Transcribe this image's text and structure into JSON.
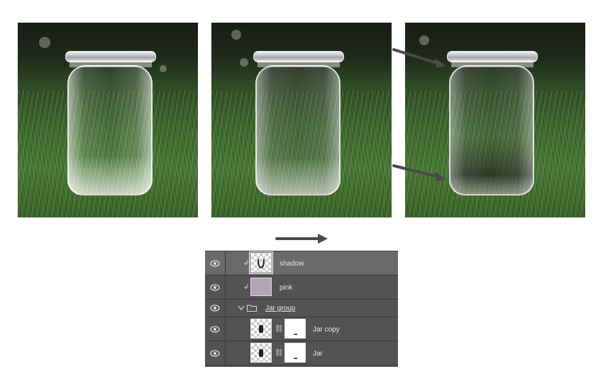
{
  "photos": [
    {
      "label": "original-jar"
    },
    {
      "label": "pink-tint-jar"
    },
    {
      "label": "shadow-jar"
    }
  ],
  "layers": [
    {
      "name": "shadow",
      "kind": "clipped-layer",
      "icon": "clip-arrow-icon",
      "selected": true
    },
    {
      "name": "pink",
      "kind": "clipped-fill",
      "icon": "clip-arrow-icon",
      "color": "#b4a4b6"
    },
    {
      "name": "Jar group",
      "kind": "group",
      "icon": "folder-icon"
    },
    {
      "name": "Jar copy",
      "kind": "layer-with-mask",
      "icon": "chain-link-icon"
    },
    {
      "name": "Jar",
      "kind": "layer-with-mask",
      "icon": "chain-link-icon"
    }
  ],
  "colors": {
    "panel_bg": "#535353",
    "selected_row_bg": "#6a6a6a",
    "label_text": "#e6e6e6",
    "pink_swatch": "#b4a4b6",
    "arrow": "#4a4a4a"
  }
}
